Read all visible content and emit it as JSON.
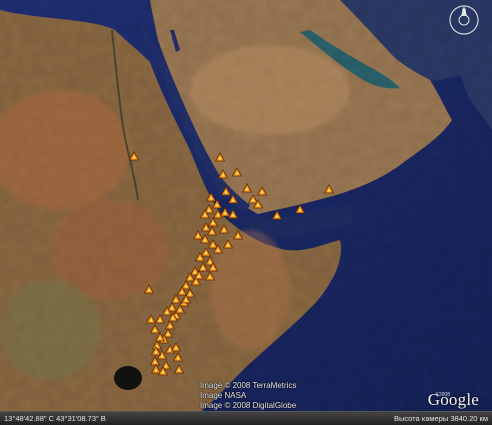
{
  "map": {
    "credits": [
      "Image © 2008 TerraMetrics",
      "Image NASA",
      "Image © 2008 DigitalGlobe"
    ],
    "logo": "Google",
    "logo_mark": "©2008",
    "compass_label": "N",
    "volcano_marker_color": "#f39a1c",
    "volcano_marker_count": 80
  },
  "status_bar": {
    "pointer": "13°48'42.88\" С     43°31'08.73\" В",
    "altitude": "Высота камеры  3840.20 км"
  },
  "colors": {
    "sea": "#1b2a67",
    "land_dark": "#5b4b32",
    "land_light": "#b48a5d",
    "land_red": "#b05a3a"
  }
}
